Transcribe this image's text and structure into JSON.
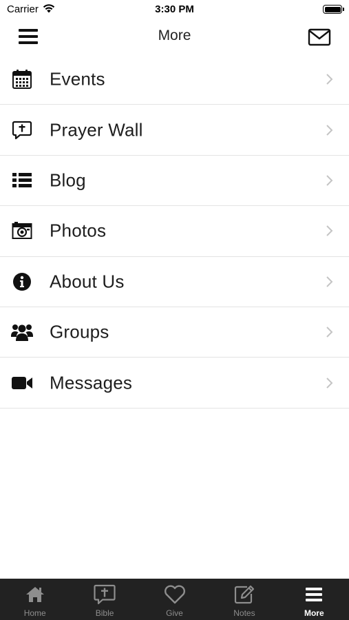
{
  "status_bar": {
    "carrier": "Carrier",
    "time": "3:30 PM"
  },
  "nav": {
    "title": "More",
    "menu_icon": "hamburger-icon",
    "mail_icon": "envelope-icon"
  },
  "menu_items": [
    {
      "label": "Events",
      "icon": "calendar-icon"
    },
    {
      "label": "Prayer Wall",
      "icon": "prayer-wall-icon"
    },
    {
      "label": "Blog",
      "icon": "list-icon"
    },
    {
      "label": "Photos",
      "icon": "camera-icon"
    },
    {
      "label": "About Us",
      "icon": "info-icon"
    },
    {
      "label": "Groups",
      "icon": "group-icon"
    },
    {
      "label": "Messages",
      "icon": "video-icon"
    }
  ],
  "tab_bar": {
    "tabs": [
      {
        "label": "Home",
        "icon": "home-icon"
      },
      {
        "label": "Bible",
        "icon": "bible-icon"
      },
      {
        "label": "Give",
        "icon": "heart-icon"
      },
      {
        "label": "Notes",
        "icon": "edit-icon"
      },
      {
        "label": "More",
        "icon": "hamburger-icon",
        "active": true
      }
    ]
  },
  "colors": {
    "tab_bar_bg": "#222222",
    "tab_inactive": "#8e8e8e",
    "tab_active": "#ffffff",
    "text": "#1e1e1e",
    "divider": "#e3e3e3"
  }
}
